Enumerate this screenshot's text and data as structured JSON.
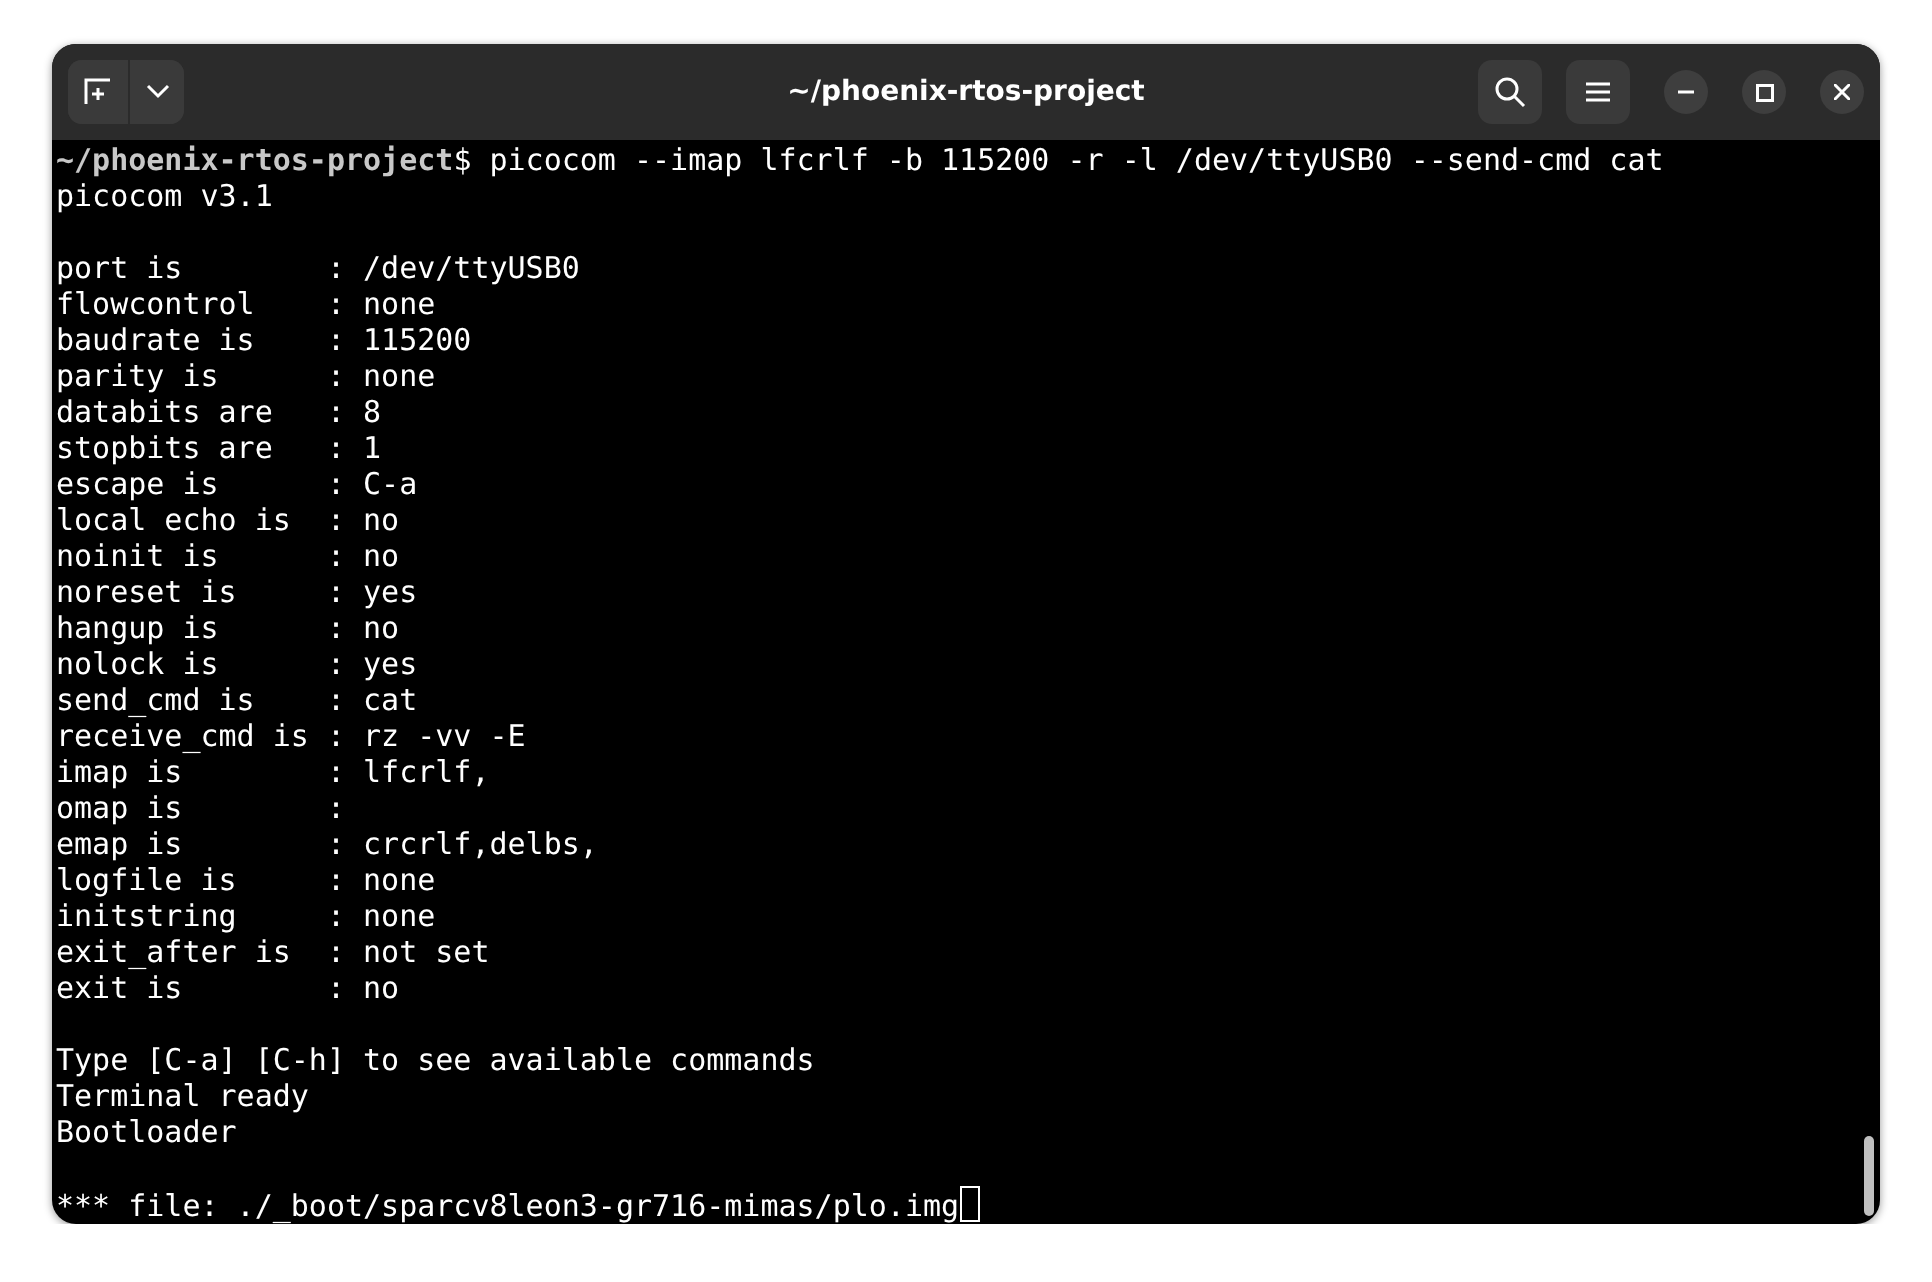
{
  "window": {
    "title": "~/phoenix-rtos-project"
  },
  "terminal": {
    "prompt_path": "~/phoenix-rtos-project",
    "prompt_symbol": "$",
    "command": "picocom --imap lfcrlf -b 115200 -r -l /dev/ttyUSB0 --send-cmd cat",
    "blocks": [
      [
        "picocom v3.1"
      ],
      [
        "port is        : /dev/ttyUSB0",
        "flowcontrol    : none",
        "baudrate is    : 115200",
        "parity is      : none",
        "databits are   : 8",
        "stopbits are   : 1",
        "escape is      : C-a",
        "local echo is  : no",
        "noinit is      : no",
        "noreset is     : yes",
        "hangup is      : no",
        "nolock is      : yes",
        "send_cmd is    : cat",
        "receive_cmd is : rz -vv -E",
        "imap is        : lfcrlf,",
        "omap is        :",
        "emap is        : crcrlf,delbs,",
        "logfile is     : none",
        "initstring     : none",
        "exit_after is  : not set",
        "exit is        : no"
      ],
      [
        "Type [C-a] [C-h] to see available commands",
        "Terminal ready",
        "Bootloader"
      ],
      [
        "*** file: ./_boot/sparcv8leon3-gr716-mimas/plo.img"
      ]
    ],
    "cursor_visible": true
  }
}
